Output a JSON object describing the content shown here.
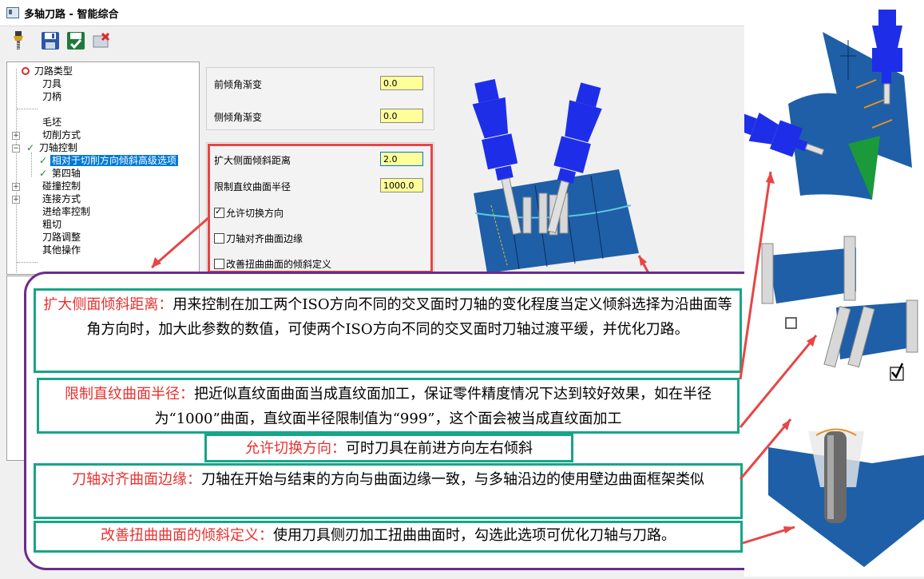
{
  "window": {
    "title": "多轴刀路 - 智能综合"
  },
  "toolbar": {
    "icons": [
      "tool-icon",
      "save-icon",
      "save-close-icon",
      "cancel-icon"
    ]
  },
  "tree": {
    "items": [
      {
        "label": "刀路类型",
        "status": "error"
      },
      {
        "label": "刀具"
      },
      {
        "label": "刀柄"
      },
      {
        "label": "毛坯"
      },
      {
        "label": "切削方式"
      },
      {
        "label": "刀轴控制",
        "status": "ok"
      },
      {
        "label": "相对于切削方向倾斜高级选项",
        "status": "ok",
        "selected": true
      },
      {
        "label": "第四轴",
        "status": "ok"
      },
      {
        "label": "碰撞控制"
      },
      {
        "label": "连接方式"
      },
      {
        "label": "进给率控制"
      },
      {
        "label": "粗切"
      },
      {
        "label": "刀路调整"
      },
      {
        "label": "其他操作"
      }
    ]
  },
  "group1": {
    "lead_label": "前倾角渐变",
    "lead_value": "0.0",
    "side_label": "侧倾角渐变",
    "side_value": "0.0"
  },
  "group2": {
    "expand_label": "扩大侧面倾斜距离",
    "expand_value": "2.0",
    "limit_label": "限制直纹曲面半径",
    "limit_value": "1000.0",
    "allow_label": "允许切换方向",
    "allow_checked": true,
    "align_label": "刀轴对齐曲面边缘",
    "align_checked": false,
    "improve_label": "改善扭曲曲面的倾斜定义",
    "improve_checked": false
  },
  "notes": {
    "n1_head": "扩大侧面倾斜距离：",
    "n1_body": "用来控制在加工两个ISO方向不同的交叉面时刀轴的变化程度当定义倾斜选择为沿曲面等角方向时，加大此参数的数值，可使两个ISO方向不同的交叉面时刀轴过渡平缓，并优化刀路。",
    "n2_head": "限制直纹曲面半径：",
    "n2_body": "把近似直纹面曲面当成直纹面加工，保证零件精度情况下达到较好效果，如在半径为“1000”曲面，直纹面半径限制值为“999”，这个面会被当成直纹面加工",
    "n3_head": "允许切换方向：",
    "n3_body": "可时刀具在前进方向左右倾斜",
    "n4_head": "刀轴对齐曲面边缘：",
    "n4_body": "刀轴在开始与结束的方向与曲面边缘一致，与多轴沿边的使用壁边曲面框架类似",
    "n5_head": "改善扭曲曲面的倾斜定义：",
    "n5_body": "使用刀具侧刃加工扭曲曲面时，勾选此选项可优化刀轴与刀路。"
  },
  "colors": {
    "highlight_red": "#e84545",
    "callout_purple": "#6b2c8b",
    "note_border_teal": "#17a589",
    "heading_red": "#e8302f",
    "input_yellow": "#ffff99",
    "selection_blue": "#0078d7",
    "tool_blue": "#1e2ee8"
  }
}
